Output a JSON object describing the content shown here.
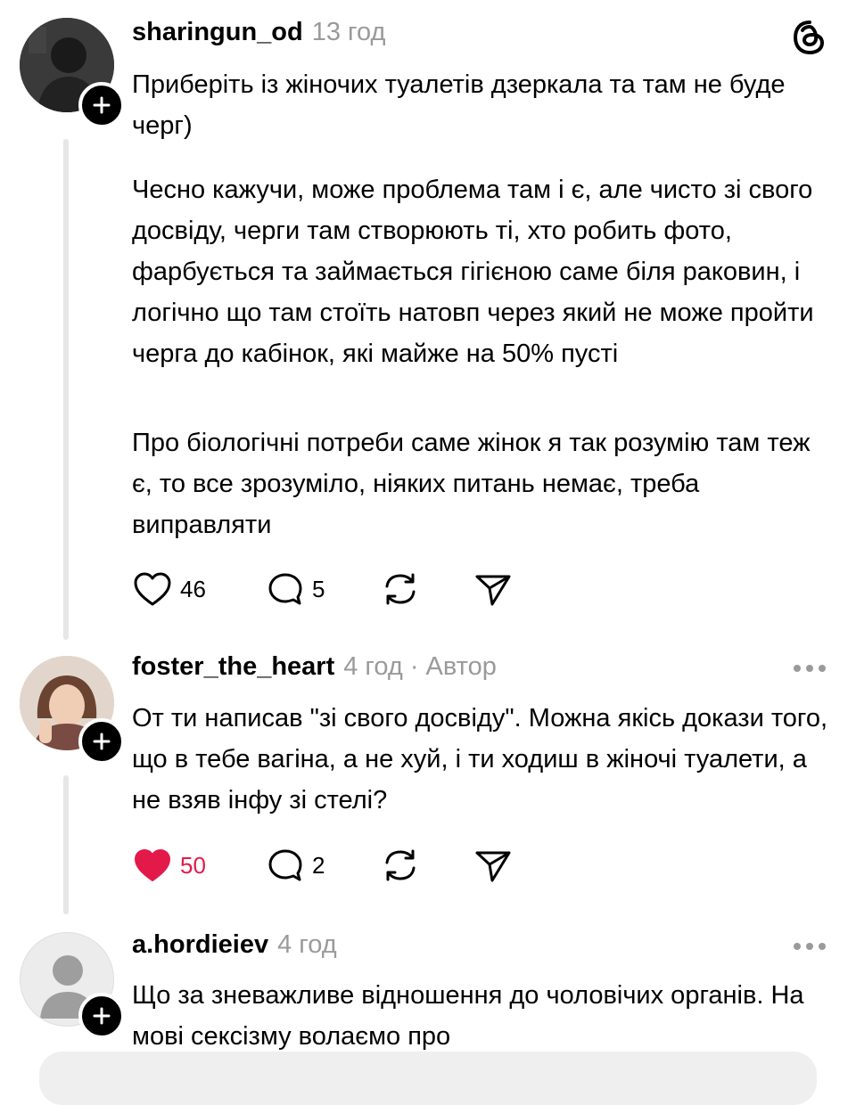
{
  "accent_like_color": "#e3194a",
  "header": {
    "app_icon": "threads-logo-icon"
  },
  "comments": [
    {
      "username": "sharingun_od",
      "time": "13 год",
      "paragraphs": [
        "Приберіть із жіночих туалетів дзеркала та там не буде черг)",
        "Чесно кажучи, може проблема там і є, але чисто зі свого досвіду, черги там створюють ті, хто робить фото, фарбується та займається гігієною саме біля раковин, і логічно що там стоїть натовп через який не може пройти черга до кабінок, які майже на 50% пусті",
        "Про біологічні потреби саме жінок я так розумію там теж є, то все зрозуміло, ніяких питань немає, треба виправляти"
      ],
      "likes": "46",
      "replies": "5",
      "liked": false
    },
    {
      "username": "foster_the_heart",
      "time": "4 год · Автор",
      "paragraphs": [
        "От ти написав \"зі свого досвіду\". Можна якісь докази того, що в тебе вагіна, а не хуй, і ти ходиш в жіночі туалети, а не взяв інфу зі стелі?"
      ],
      "likes": "50",
      "replies": "2",
      "liked": true
    },
    {
      "username": "a.hordieiev",
      "time": "4 год",
      "paragraphs": [
        "Що за зневажливе відношення до чоловічих органів. На мові сексізму волаємо про"
      ]
    }
  ]
}
